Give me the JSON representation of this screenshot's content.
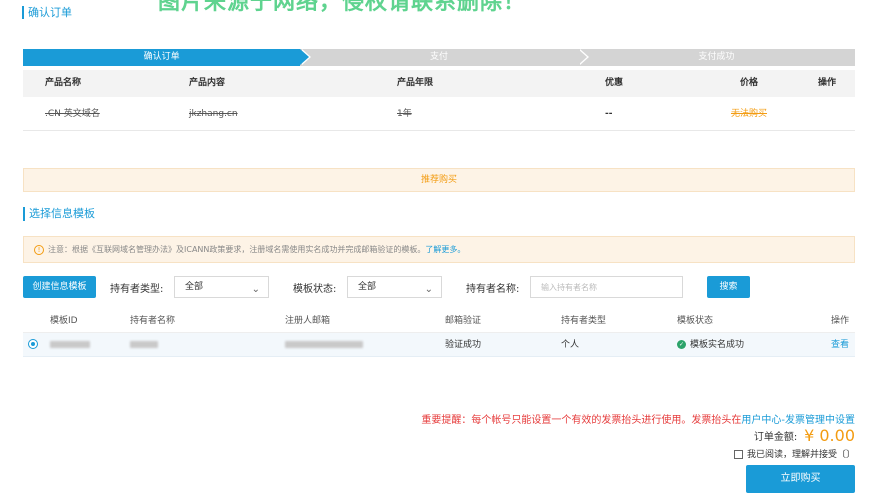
{
  "page": {
    "title": "确认订单",
    "watermark": "图片来源于网络，侵权请联系删除！"
  },
  "steps": [
    {
      "label": "确认订单",
      "state": "active"
    },
    {
      "label": "支付",
      "state": "inactive"
    },
    {
      "label": "支付成功",
      "state": "inactive"
    }
  ],
  "order": {
    "headers": [
      "产品名称",
      "产品内容",
      "产品年限",
      "优惠",
      "价格",
      "操作"
    ],
    "row": {
      "name": ".CN 英文域名",
      "content": "jkzhang.cn",
      "years": "1年",
      "discount": "--",
      "price": "无法购买",
      "action": ""
    }
  },
  "recommend": {
    "label": "推荐购买"
  },
  "template_section": {
    "title": "选择信息模板",
    "notice": {
      "text": "注意：根据《互联网域名管理办法》及ICANN政策要求，注册域名需使用实名成功并完成邮箱验证的模板。",
      "link": "了解更多。"
    }
  },
  "filters": {
    "create_button": "创建信息模板",
    "holder_type_label": "持有者类型:",
    "holder_type_value": "全部",
    "status_label": "模板状态:",
    "status_value": "全部",
    "holder_name_label": "持有者名称:",
    "holder_name_placeholder": "输入持有者名称",
    "search_button": "搜索"
  },
  "templates": {
    "headers": [
      "模板ID",
      "持有者名称",
      "注册人邮箱",
      "邮箱验证",
      "持有者类型",
      "模板状态",
      "操作"
    ],
    "rows": [
      {
        "email_verify": "验证成功",
        "holder_type": "个人",
        "status": "模板实名成功",
        "action": "查看"
      }
    ]
  },
  "bottom": {
    "reminder": "重要提醒：每个帐号只能设置一个有效的发票抬头进行使用。发票抬头在",
    "reminder_link": "用户中心-发票管理中设置",
    "total_label": "订单金额:",
    "total_amount": "¥ 0.00",
    "agree_text": "我已阅读，理解并接受〔〕",
    "buy_button": "立即购买"
  },
  "colors": {
    "accent": "#1a9bd7",
    "price": "#f39c12",
    "warning": "#e63c3c",
    "success": "#2ca36a"
  }
}
